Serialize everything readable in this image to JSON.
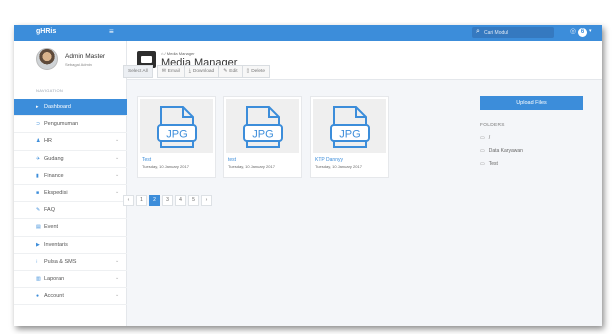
{
  "topbar": {
    "brand": "gHRis",
    "menu_icon": "hamburger-icon",
    "search_placeholder": "Cari Modul",
    "notification_count": "6",
    "accent_color": "#3c8dda"
  },
  "user": {
    "name": "Admin Master",
    "role": "Sebagai Admin"
  },
  "sidebar": {
    "header": "NAVIGATION",
    "items": [
      {
        "label": "Dashboard",
        "icon": "dashboard-icon",
        "has_children": false,
        "active": true
      },
      {
        "label": "Pengumuman",
        "icon": "announcement-icon",
        "has_children": false,
        "active": false
      },
      {
        "label": "HR",
        "icon": "hr-icon",
        "has_children": true,
        "active": false
      },
      {
        "label": "Gudang",
        "icon": "warehouse-icon",
        "has_children": true,
        "active": false
      },
      {
        "label": "Finance",
        "icon": "finance-icon",
        "has_children": true,
        "active": false
      },
      {
        "label": "Ekspedisi",
        "icon": "shipping-icon",
        "has_children": true,
        "active": false
      },
      {
        "label": "FAQ",
        "icon": "faq-icon",
        "has_children": false,
        "active": false
      },
      {
        "label": "Event",
        "icon": "event-icon",
        "has_children": false,
        "active": false
      },
      {
        "label": "Inventaris",
        "icon": "inventory-icon",
        "has_children": false,
        "active": false
      },
      {
        "label": "Pulsa & SMS",
        "icon": "phone-icon",
        "has_children": true,
        "active": false
      },
      {
        "label": "Laporan",
        "icon": "report-icon",
        "has_children": true,
        "active": false
      },
      {
        "label": "Account",
        "icon": "account-icon",
        "has_children": true,
        "active": false
      }
    ]
  },
  "header": {
    "breadcrumb": "Media Manager",
    "title": "Media Manager"
  },
  "toolbar": {
    "select_all": "Select All",
    "email": "Email",
    "download": "Download",
    "edit": "Edit",
    "delete": "Delete"
  },
  "files": [
    {
      "name": "Test",
      "date": "Tuesday, 10 January 2017",
      "type": "JPG"
    },
    {
      "name": "test",
      "date": "Tuesday, 10 January 2017",
      "type": "JPG"
    },
    {
      "name": "KTP Dannyy",
      "date": "Tuesday, 10 January 2017",
      "type": "JPG"
    }
  ],
  "pagination": {
    "prev": "‹",
    "next": "›",
    "pages": [
      "1",
      "2",
      "3",
      "4",
      "5"
    ],
    "current": "2"
  },
  "right_panel": {
    "upload_label": "Upload Files",
    "folders_title": "FOLDERS",
    "folders": [
      "/",
      "Data Karyawan",
      "Test"
    ]
  }
}
